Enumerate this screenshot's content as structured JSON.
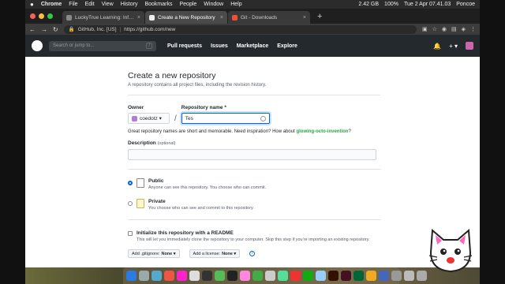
{
  "menubar": {
    "apple": "",
    "items": [
      "Chrome",
      "File",
      "Edit",
      "View",
      "History",
      "Bookmarks",
      "People",
      "Window",
      "Help"
    ],
    "status": "2.42 GB",
    "battery": "100%",
    "clock": "Tue 2 Apr  07.41.03",
    "user": "Poncoe"
  },
  "tabs": [
    {
      "title": "LuckyTrue Learning: Informasi",
      "close": "×"
    },
    {
      "title": "Create a New Repository",
      "close": "×"
    },
    {
      "title": "Git - Downloads",
      "close": "×"
    }
  ],
  "newtab": "+",
  "address": {
    "org": "GitHub, Inc. [US]",
    "url": "https://github.com/new"
  },
  "github": {
    "search_placeholder": "Search or jump to...",
    "search_key": "/",
    "nav": [
      "Pull requests",
      "Issues",
      "Marketplace",
      "Explore"
    ],
    "bell": "🔔",
    "plus": "+ ▾"
  },
  "form": {
    "title": "Create a new repository",
    "subtitle": "A repository contains all project files, including the revision history.",
    "owner_label": "Owner",
    "owner_value": "coedotz ▾",
    "repo_label": "Repository name *",
    "repo_value": "Tes",
    "slash": "/",
    "hint_prefix": "Great repository names are short and memorable. Need inspiration? How about",
    "hint_suggestion": "glowing-octo-invention",
    "hint_suffix": "?",
    "description_label": "Description",
    "description_optional": "(optional)",
    "public_title": "Public",
    "public_text": "Anyone can see this repository. You choose who can commit.",
    "private_title": "Private",
    "private_text": "You choose who can see and commit to this repository.",
    "readme_title": "Initialize this repository with a README",
    "readme_text": "This will let you immediately clone the repository to your computer. Skip this step if you’re importing an existing repository.",
    "gitignore_label": "Add .gitignore:",
    "gitignore_value": "None ▾",
    "license_label": "Add a license:",
    "license_value": "None ▾",
    "info": "i"
  },
  "colors": {
    "accent": "#0366d6",
    "suggestion": "#28a745",
    "header_bg": "#24292e"
  }
}
